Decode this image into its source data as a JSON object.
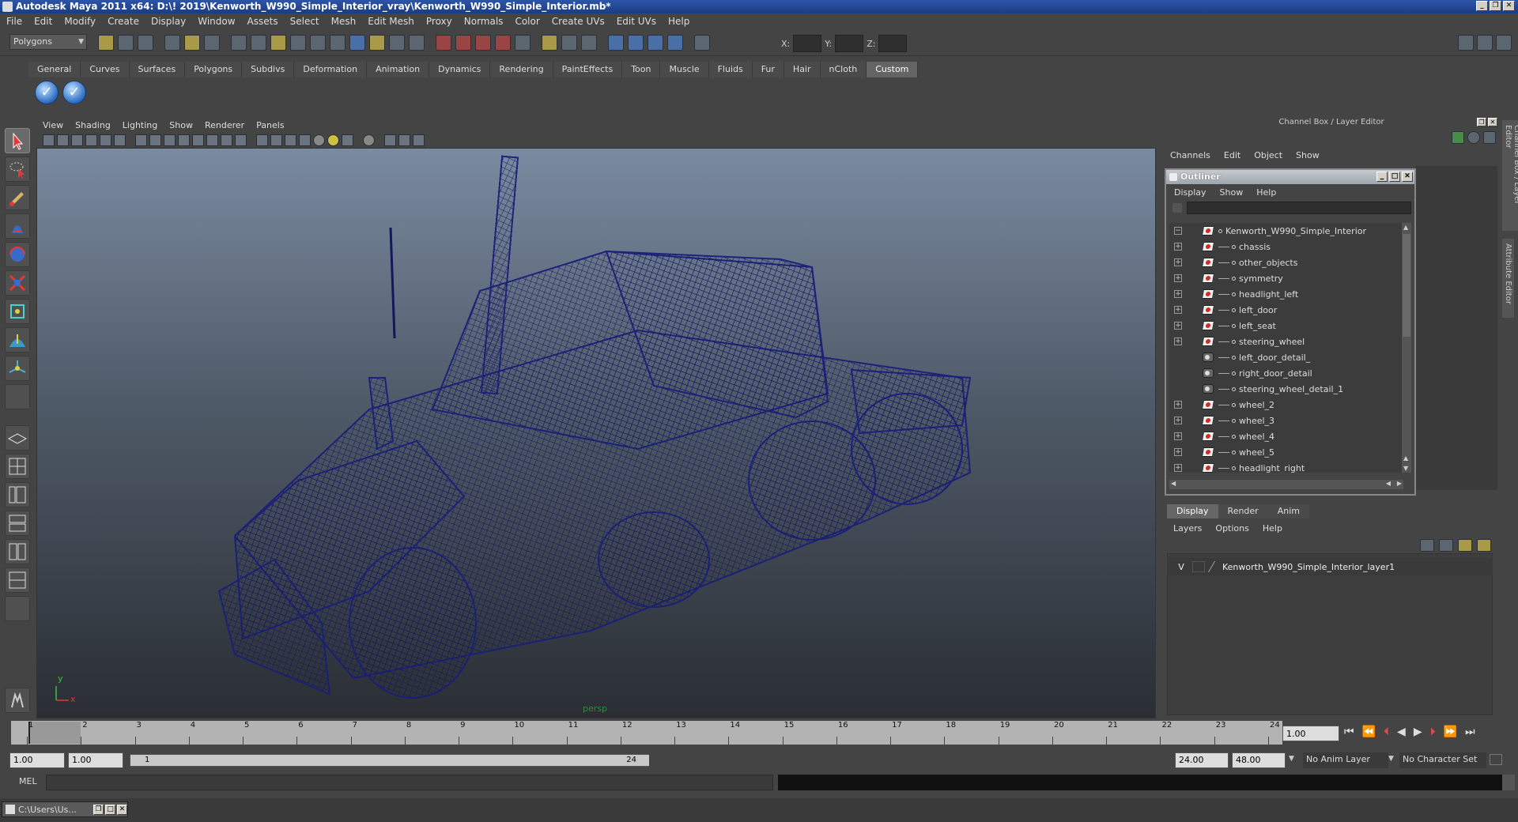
{
  "window": {
    "title": "Autodesk Maya 2011 x64: D:\\! 2019\\Kenworth_W990_Simple_Interior_vray\\Kenworth_W990_Simple_Interior.mb*"
  },
  "menubar": [
    "File",
    "Edit",
    "Modify",
    "Create",
    "Display",
    "Window",
    "Assets",
    "Select",
    "Mesh",
    "Edit Mesh",
    "Proxy",
    "Normals",
    "Color",
    "Create UVs",
    "Edit UVs",
    "Help"
  ],
  "statusline": {
    "mode_selector": "Polygons",
    "coord_x_label": "X:",
    "coord_y_label": "Y:",
    "coord_z_label": "Z:"
  },
  "shelf_tabs": [
    "General",
    "Curves",
    "Surfaces",
    "Polygons",
    "Subdivs",
    "Deformation",
    "Animation",
    "Dynamics",
    "Rendering",
    "PaintEffects",
    "Toon",
    "Muscle",
    "Fluids",
    "Fur",
    "Hair",
    "nCloth",
    "Custom"
  ],
  "active_shelf": "Custom",
  "viewport": {
    "menu": [
      "View",
      "Shading",
      "Lighting",
      "Show",
      "Renderer",
      "Panels"
    ],
    "camera_label": "persp",
    "axis_y": "y",
    "axis_x": "x",
    "wire_color": "#1a1f7a",
    "bg_top": "#7a8aa0",
    "bg_bottom": "#2a2e34"
  },
  "channel_box": {
    "header": "Channel Box / Layer Editor",
    "menu": [
      "Channels",
      "Edit",
      "Object",
      "Show"
    ]
  },
  "outliner": {
    "title": "Outliner",
    "menu": [
      "Display",
      "Show",
      "Help"
    ],
    "items": [
      {
        "name": "Kenworth_W990_Simple_Interior",
        "type": "root"
      },
      {
        "name": "chassis",
        "type": "mesh"
      },
      {
        "name": "other_objects",
        "type": "mesh"
      },
      {
        "name": "symmetry",
        "type": "mesh"
      },
      {
        "name": "headlight_left",
        "type": "mesh"
      },
      {
        "name": "left_door",
        "type": "mesh"
      },
      {
        "name": "left_seat",
        "type": "mesh"
      },
      {
        "name": "steering_wheel",
        "type": "mesh"
      },
      {
        "name": "left_door_detail_",
        "type": "group"
      },
      {
        "name": "right_door_detail",
        "type": "group"
      },
      {
        "name": "steering_wheel_detail_1",
        "type": "group"
      },
      {
        "name": "wheel_2",
        "type": "mesh"
      },
      {
        "name": "wheel_3",
        "type": "mesh"
      },
      {
        "name": "wheel_4",
        "type": "mesh"
      },
      {
        "name": "wheel_5",
        "type": "mesh"
      },
      {
        "name": "headlight_right",
        "type": "mesh"
      }
    ]
  },
  "layer_editor": {
    "tabs": [
      "Display",
      "Render",
      "Anim"
    ],
    "menu": [
      "Layers",
      "Options",
      "Help"
    ],
    "layer_visible": "V",
    "layer_name": "Kenworth_W990_Simple_Interior_layer1"
  },
  "side_tabs": [
    "Channel Box / Layer Editor",
    "Attribute Editor"
  ],
  "timeline": {
    "ticks": [
      "1",
      "2",
      "3",
      "4",
      "5",
      "6",
      "7",
      "8",
      "9",
      "10",
      "11",
      "12",
      "13",
      "14",
      "15",
      "16",
      "17",
      "18",
      "19",
      "20",
      "21",
      "22",
      "23",
      "24"
    ],
    "current_frame": "1.00"
  },
  "range": {
    "start": "1.00",
    "playback_start": "1.00",
    "slider_start": "1",
    "slider_end": "24",
    "playback_end": "24.00",
    "end": "48.00",
    "anim_layer": "No Anim Layer",
    "character_set": "No Character Set"
  },
  "command_line": {
    "label": "MEL"
  },
  "taskbar": {
    "item": "C:\\Users\\Us..."
  }
}
